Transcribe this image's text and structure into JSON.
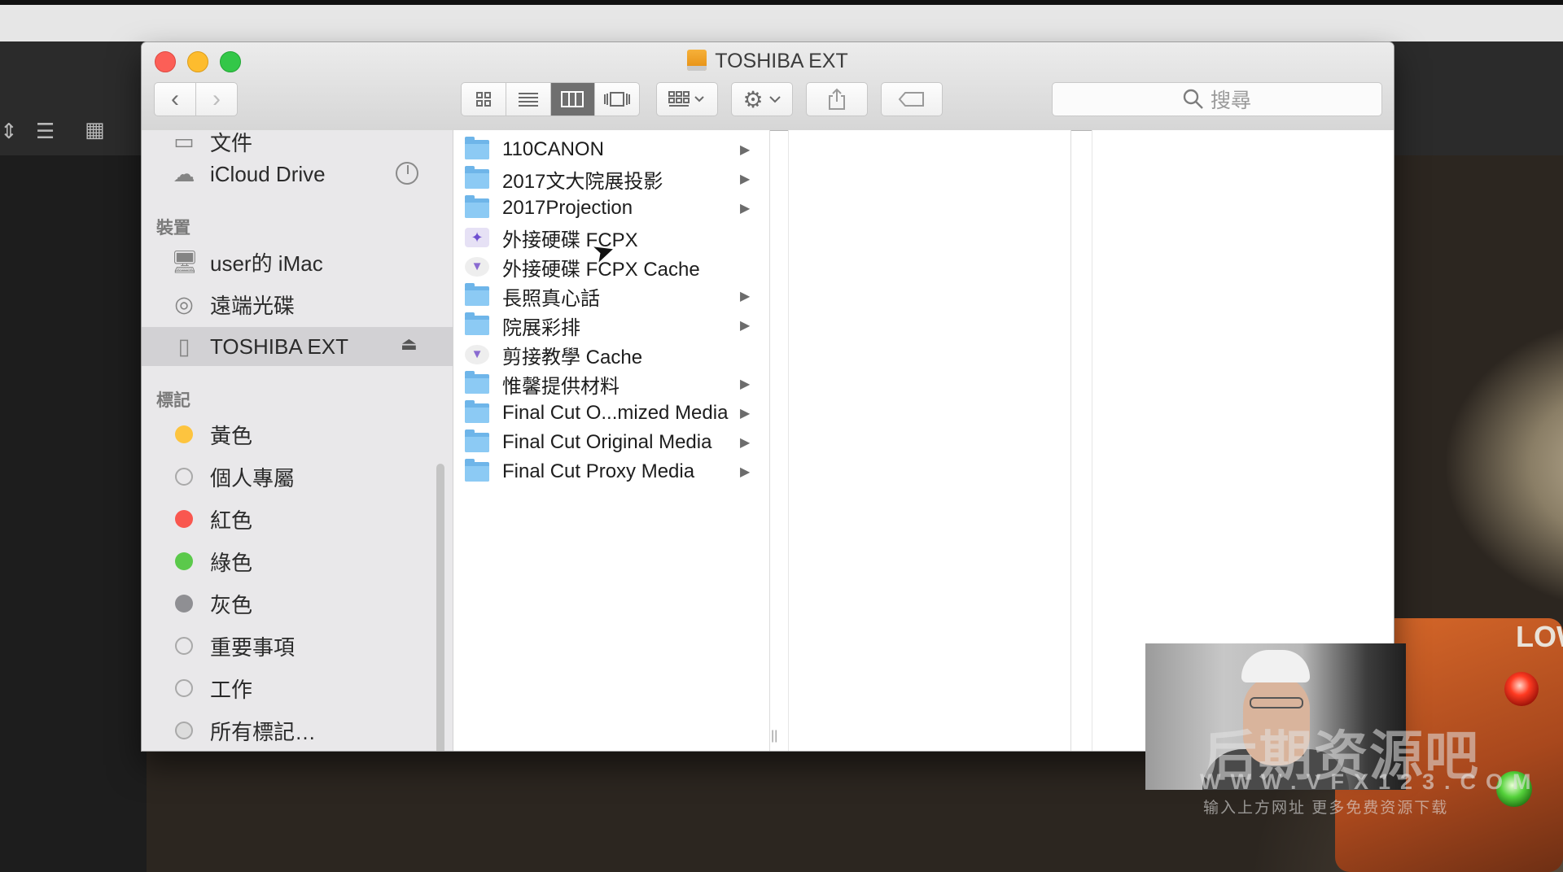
{
  "window": {
    "title": "TOSHIBA EXT"
  },
  "toolbar": {
    "back_icon": "chevron-left-icon",
    "forward_icon": "chevron-right-icon",
    "search_placeholder": "搜尋",
    "active_view": "column"
  },
  "sidebar": {
    "partial_item": "文件",
    "icloud_label": "iCloud Drive",
    "devices_heading": "裝置",
    "devices": [
      {
        "label": "user的 iMac",
        "icon": "imac-icon"
      },
      {
        "label": "遠端光碟",
        "icon": "disc-icon"
      },
      {
        "label": "TOSHIBA EXT",
        "icon": "external-drive-icon",
        "selected": true
      }
    ],
    "tags_heading": "標記",
    "tags": [
      {
        "label": "黃色",
        "color": "#fdc43f"
      },
      {
        "label": "個人專屬",
        "color": "none"
      },
      {
        "label": "紅色",
        "color": "#f9574f"
      },
      {
        "label": "綠色",
        "color": "#5bc94b"
      },
      {
        "label": "灰色",
        "color": "#8f8f93"
      },
      {
        "label": "重要事項",
        "color": "none"
      },
      {
        "label": "工作",
        "color": "none"
      },
      {
        "label": "所有標記…",
        "color": "all"
      }
    ]
  },
  "files": [
    {
      "name": "110CANON",
      "kind": "folder",
      "has_children": true
    },
    {
      "name": "2017文大院展投影",
      "kind": "folder",
      "has_children": true
    },
    {
      "name": "2017Projection",
      "kind": "folder",
      "has_children": true
    },
    {
      "name": "外接硬碟 FCPX",
      "kind": "fcpx-library",
      "has_children": false
    },
    {
      "name": "外接硬碟 FCPX Cache",
      "kind": "fcpx-cache",
      "has_children": false
    },
    {
      "name": "長照真心話",
      "kind": "folder",
      "has_children": true
    },
    {
      "name": "院展彩排",
      "kind": "folder",
      "has_children": true
    },
    {
      "name": "剪接教學 Cache",
      "kind": "fcpx-cache",
      "has_children": false
    },
    {
      "name": "惟馨提供材料",
      "kind": "folder",
      "has_children": true
    },
    {
      "name": "Final Cut O...mized Media",
      "kind": "folder",
      "has_children": true
    },
    {
      "name": "Final Cut Original Media",
      "kind": "folder",
      "has_children": true
    },
    {
      "name": "Final Cut Proxy Media",
      "kind": "folder",
      "has_children": true
    }
  ],
  "background": {
    "low_label": "LOW"
  },
  "watermark": {
    "main": "后期资源吧",
    "url": "WWW.VFX123.COM",
    "sub": "输入上方网址 更多免费资源下载"
  }
}
